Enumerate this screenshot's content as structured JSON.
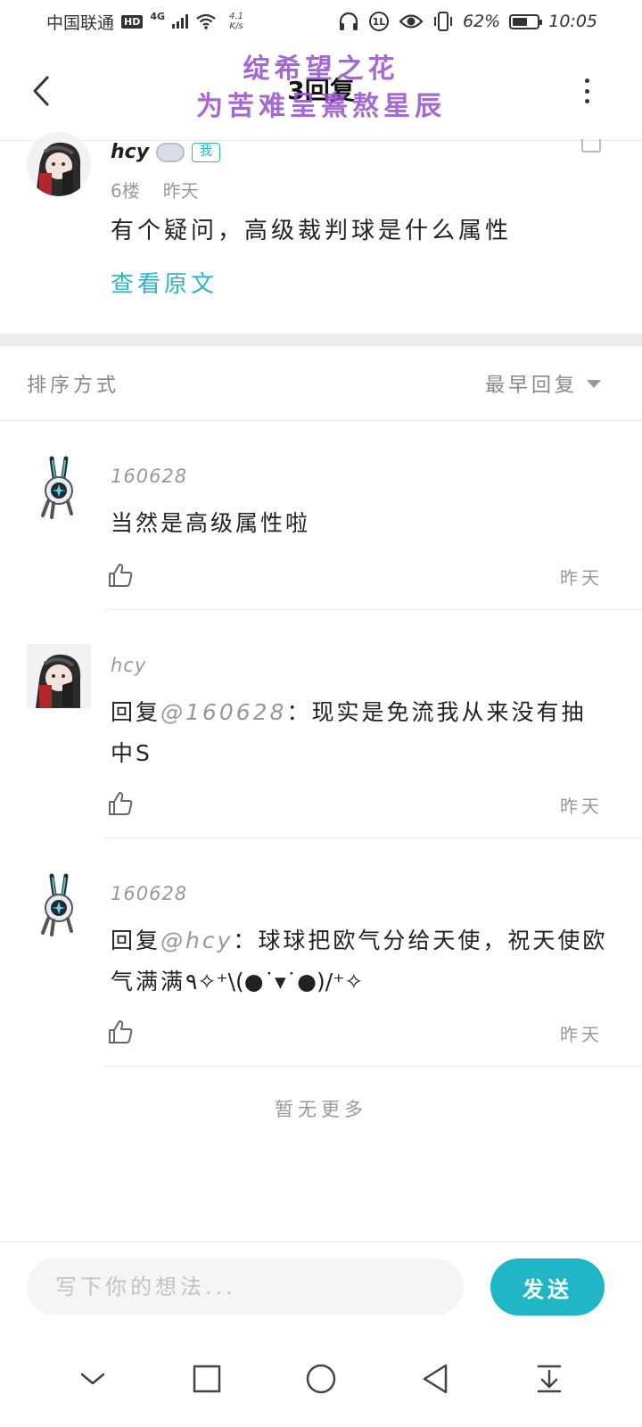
{
  "status_bar": {
    "carrier": "中国联通",
    "hd": "HD",
    "network": "4G",
    "speed_value": "4.1",
    "speed_unit": "K/s",
    "battery_percent": "62%",
    "battery_level": 0.62,
    "time": "10:05",
    "icons": [
      "headphones-icon",
      "data-saver-icon",
      "eye-icon",
      "vibrate-icon",
      "battery-icon"
    ]
  },
  "header": {
    "title": "3回复",
    "watermark_line1": "绽希望之花",
    "watermark_line2": "为苦难呈熹熬星辰"
  },
  "original_post": {
    "author": "hcy",
    "me_badge": "我",
    "floor": "6楼",
    "time": "昨天",
    "text": "有个疑问，高级裁判球是什么属性",
    "view_original": "查看原文"
  },
  "sort": {
    "label": "排序方式",
    "selected": "最早回复"
  },
  "replies": [
    {
      "author": "160628",
      "reply_prefix": "",
      "mention": "",
      "text": "当然是高级属性啦",
      "time": "昨天"
    },
    {
      "author": "hcy",
      "reply_prefix": "回复",
      "mention": "@160628",
      "text": "：现实是免流我从来没有抽中S",
      "time": "昨天"
    },
    {
      "author": "160628",
      "reply_prefix": "回复",
      "mention": "@hcy",
      "text": "：球球把欧气分给天使，祝天使欧气满满٩✧⁺\\(●˙▾˙●)/⁺✧",
      "time": "昨天"
    }
  ],
  "no_more": "暂无更多",
  "composer": {
    "placeholder": "写下你的想法...",
    "send_label": "发送"
  },
  "colors": {
    "accent": "#1fb6c6",
    "watermark": "#9b59d0",
    "muted_text": "#999999"
  }
}
